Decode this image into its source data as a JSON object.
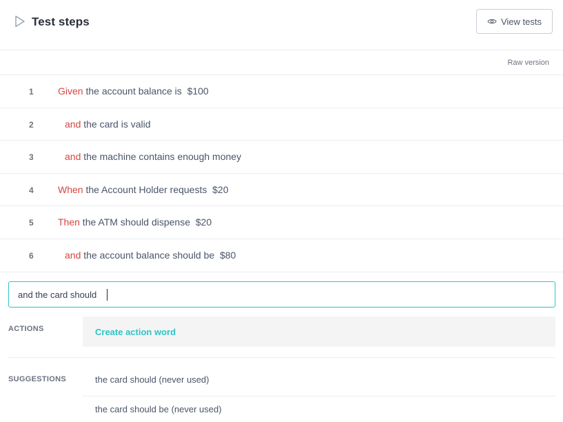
{
  "header": {
    "title": "Test steps",
    "view_tests_label": "View tests"
  },
  "toolbar": {
    "raw_version_label": "Raw version"
  },
  "steps": [
    {
      "num": "1",
      "keyword": "Given",
      "text": " the account balance is  $100",
      "indent": false
    },
    {
      "num": "2",
      "keyword": "and",
      "text": " the card is valid",
      "indent": true
    },
    {
      "num": "3",
      "keyword": "and",
      "text": " the machine contains enough money",
      "indent": true
    },
    {
      "num": "4",
      "keyword": "When",
      "text": " the Account Holder requests  $20",
      "indent": false
    },
    {
      "num": "5",
      "keyword": "Then",
      "text": " the ATM should dispense  $20",
      "indent": false
    },
    {
      "num": "6",
      "keyword": "and",
      "text": " the account balance should be  $80",
      "indent": true
    }
  ],
  "editor": {
    "value": "and the card should"
  },
  "actions": {
    "label": "ACTIONS",
    "create_action_label": "Create action word"
  },
  "suggestions": {
    "label": "SUGGESTIONS",
    "items": [
      "the card should (never used)",
      "the card should be (never used)"
    ]
  },
  "colors": {
    "keyword": "#d9443f",
    "accent": "#2ec3c6"
  },
  "icons": {
    "header_icon": "play-icon",
    "view_tests_icon": "eye-icon"
  }
}
